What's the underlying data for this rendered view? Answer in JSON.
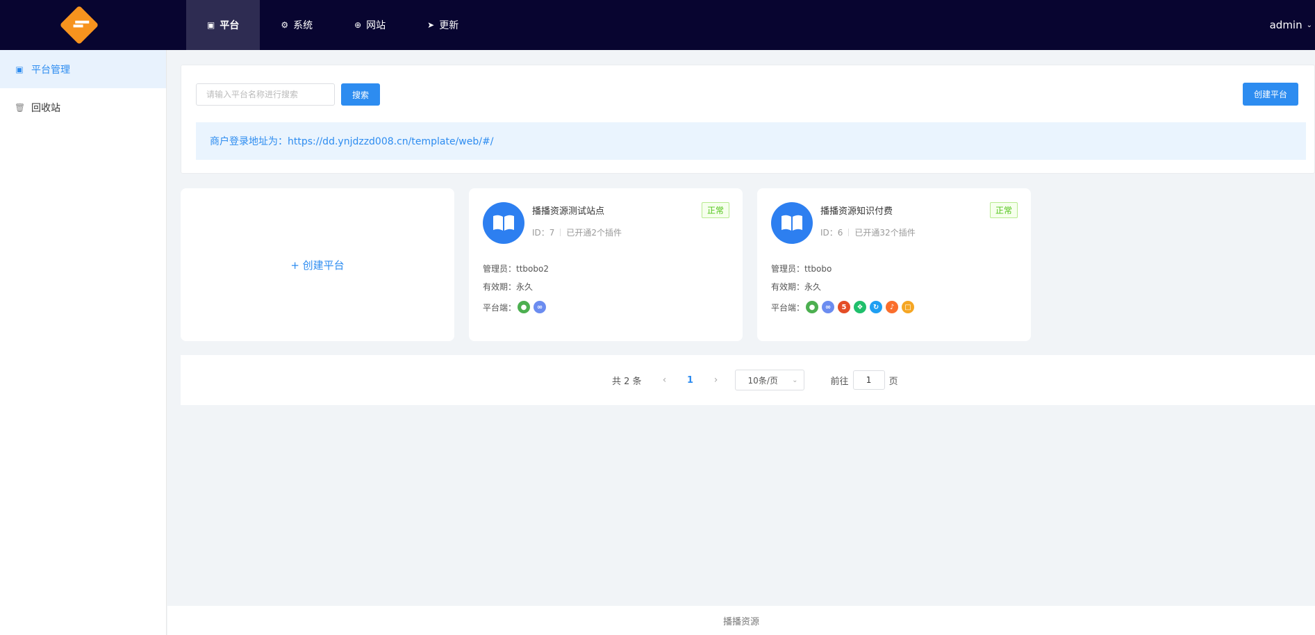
{
  "topnav": {
    "items": [
      {
        "label": "平台",
        "icon": "monitor-icon"
      },
      {
        "label": "系统",
        "icon": "gear-icon"
      },
      {
        "label": "网站",
        "icon": "plus-circle-icon"
      },
      {
        "label": "更新",
        "icon": "send-icon"
      }
    ],
    "user": "admin"
  },
  "sidebar": {
    "items": [
      {
        "label": "平台管理",
        "icon": "monitor-icon"
      },
      {
        "label": "回收站",
        "icon": "trash-icon"
      }
    ]
  },
  "search": {
    "placeholder": "请输入平台名称进行搜索",
    "value": "",
    "button_label": "搜索"
  },
  "create_button_label": "创建平台",
  "notice": "商户登录地址为：https://dd.ynjdzzd008.cn/template/web/#/",
  "add_card_label": "+ 创建平台",
  "platforms": [
    {
      "title": "播播资源测试站点",
      "id_text": "ID：7",
      "plugins_text": "已开通2个插件",
      "status": "正常",
      "admin_text": "管理员：ttbobo2",
      "valid_text": "有效期：永久",
      "platform_label": "平台端：",
      "platform_icons": [
        "wechat-icon",
        "link-icon"
      ]
    },
    {
      "title": "播播资源知识付费",
      "id_text": "ID：6",
      "plugins_text": "已开通32个插件",
      "status": "正常",
      "admin_text": "管理员：ttbobo",
      "valid_text": "有效期：永久",
      "platform_label": "平台端：",
      "platform_icons": [
        "wechat-icon",
        "link-icon",
        "html5-icon",
        "miniapp-icon",
        "sync-icon",
        "douyin-icon",
        "pc-icon"
      ]
    }
  ],
  "pagination": {
    "total_text": "共 2 条",
    "current_page": "1",
    "page_size_label": "10条/页",
    "goto_label": "前往",
    "goto_value": "1",
    "page_suffix": "页"
  },
  "footer": "播播资源",
  "colors": {
    "topbar": "#080530",
    "accent": "#2d8cf0",
    "logo": "#f7931e",
    "status_green": "#52c41a"
  }
}
